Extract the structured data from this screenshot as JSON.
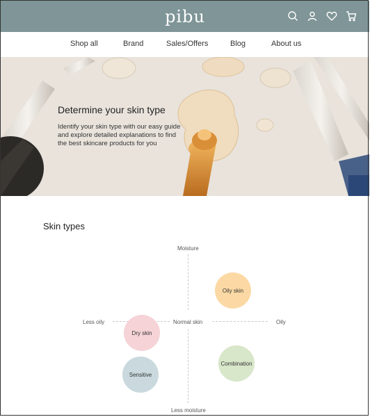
{
  "header": {
    "logo": "pibu",
    "icons": [
      "search-icon",
      "user-icon",
      "heart-icon",
      "cart-icon"
    ]
  },
  "nav": {
    "items": [
      "Shop all",
      "Brand",
      "Sales/Offers",
      "Blog",
      "About us"
    ]
  },
  "hero": {
    "title": "Determine your skin type",
    "text": "Identify your skin type with our easy guide and explore detailed explanations to find the best skincare products for you"
  },
  "skin_types": {
    "title": "Skin types",
    "axis": {
      "top": "Moisture",
      "bottom": "Less moisture",
      "left": "Less oily",
      "right": "Oily",
      "center": "Normal skin"
    },
    "types": [
      {
        "label": "Oily skin",
        "color": "#fcd9a4"
      },
      {
        "label": "Dry skin",
        "color": "#f5d3d7"
      },
      {
        "label": "Sensitive",
        "color": "#c9d9dd"
      },
      {
        "label": "Combination",
        "color": "#d8e6c9"
      }
    ]
  },
  "colors": {
    "header_bg": "#7f9597",
    "hero_bg": "#e9e3dc"
  }
}
